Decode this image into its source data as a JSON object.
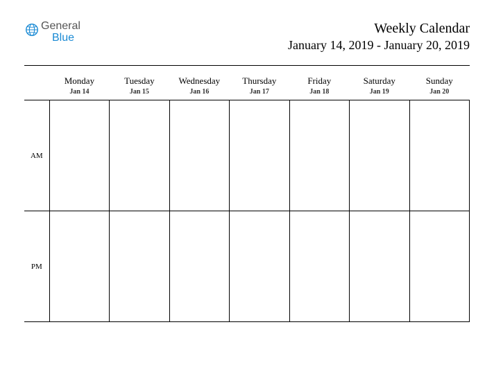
{
  "logo": {
    "line1": "General",
    "line2": "Blue"
  },
  "header": {
    "title": "Weekly Calendar",
    "date_range": "January 14, 2019 - January 20, 2019"
  },
  "days": [
    {
      "name": "Monday",
      "date": "Jan 14"
    },
    {
      "name": "Tuesday",
      "date": "Jan 15"
    },
    {
      "name": "Wednesday",
      "date": "Jan 16"
    },
    {
      "name": "Thursday",
      "date": "Jan 17"
    },
    {
      "name": "Friday",
      "date": "Jan 18"
    },
    {
      "name": "Saturday",
      "date": "Jan 19"
    },
    {
      "name": "Sunday",
      "date": "Jan 20"
    }
  ],
  "periods": {
    "am": "AM",
    "pm": "PM"
  }
}
